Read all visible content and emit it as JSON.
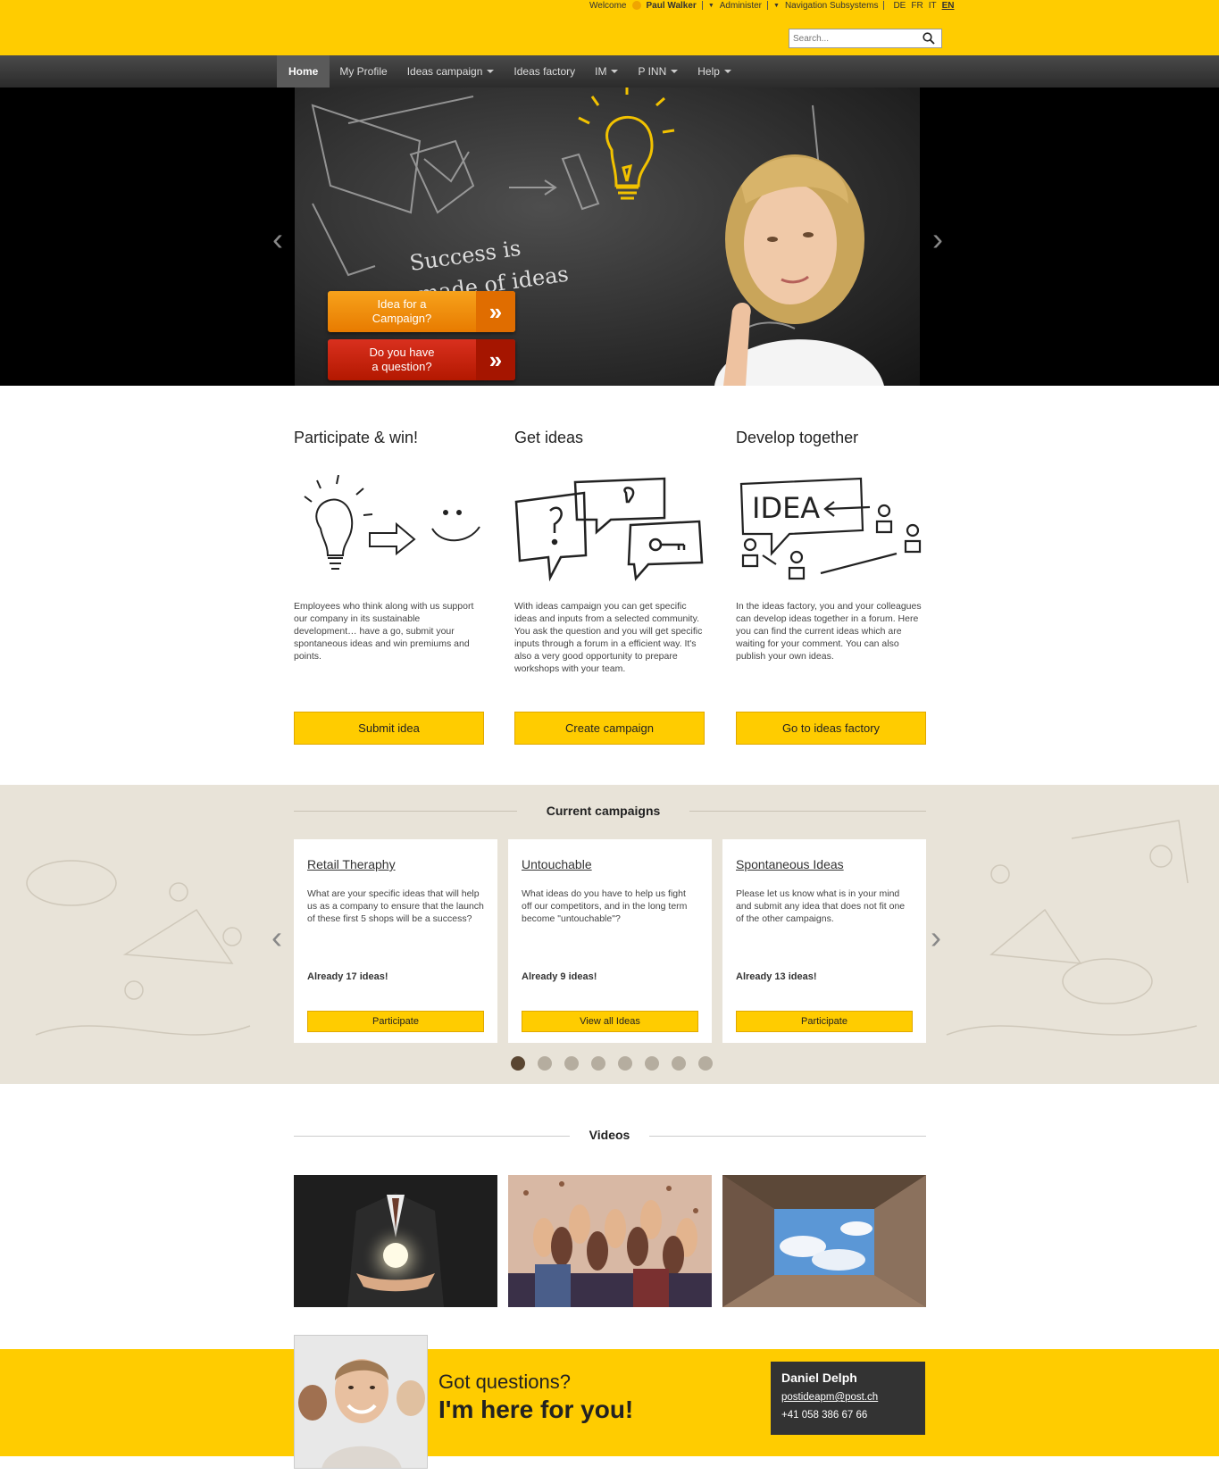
{
  "header": {
    "welcome": "Welcome",
    "user": "Paul Walker",
    "administer": "Administer",
    "navigation_subsystems": "Navigation Subsystems",
    "languages": [
      "DE",
      "FR",
      "IT",
      "EN"
    ],
    "active_language": "EN",
    "search_placeholder": "Search..."
  },
  "nav": {
    "items": [
      {
        "label": "Home",
        "active": true
      },
      {
        "label": "My Profile"
      },
      {
        "label": "Ideas campaign",
        "dropdown": true
      },
      {
        "label": "Ideas factory"
      },
      {
        "label": "IM",
        "dropdown": true
      },
      {
        "label": "P INN",
        "dropdown": true
      },
      {
        "label": "Help",
        "dropdown": true
      }
    ]
  },
  "hero": {
    "board_text_line1": "Success is",
    "board_text_line2": "made of ideas",
    "cta_campaign": "Idea for a\nCampaign?",
    "cta_question": "Do you have\na question?",
    "chevron": "»",
    "slides_total": 4,
    "active_slide": 1
  },
  "features": [
    {
      "title": "Participate & win!",
      "text": "Employees who think along with us support our company in its sustainable development… have a go, submit your spontaneous ideas and win premiums and points.",
      "button": "Submit idea"
    },
    {
      "title": "Get ideas",
      "text": "With ideas campaign you can get specific ideas and inputs from a selected community. You ask the question and you will get specific inputs through a forum in a efficient way. It's also a very good opportunity to prepare workshops with your team.",
      "button": "Create campaign"
    },
    {
      "title": "Develop together",
      "text": "In the ideas factory, you and your colleagues can develop ideas together in a forum. Here you can find the current ideas which are waiting for your comment. You can also publish your own ideas.",
      "button": "Go to ideas factory"
    }
  ],
  "campaigns": {
    "title": "Current campaigns",
    "items": [
      {
        "title": "Retail Theraphy",
        "text": "What are your specific ideas that will help us as a company to ensure that the launch of these first 5 shops will be a success?",
        "count": "Already 17 ideas!",
        "button": "Participate"
      },
      {
        "title": "Untouchable",
        "text": "What ideas do you have to help us fight off our competitors, and in the long term become \"untouchable\"?",
        "count": "Already 9 ideas!",
        "button": "View all Ideas"
      },
      {
        "title": "Spontaneous Ideas",
        "text": "Please let us know what is in your mind and submit any idea that does not fit one of the other campaigns.",
        "count": "Already 13 ideas!",
        "button": "Participate"
      }
    ],
    "dots_total": 8,
    "active_dot": 1
  },
  "videos": {
    "title": "Videos"
  },
  "contact": {
    "line1": "Got questions?",
    "line2": "I'm here for you!",
    "name": "Daniel Delph",
    "email": "postideapm@post.ch",
    "phone": "+41 058 386 67 66"
  },
  "colors": {
    "brand_yellow": "#ffcc00",
    "nav_dark": "#333333",
    "cta_orange": "#f39200",
    "cta_red": "#c8200b",
    "campaign_bg": "#e8e3d8"
  }
}
